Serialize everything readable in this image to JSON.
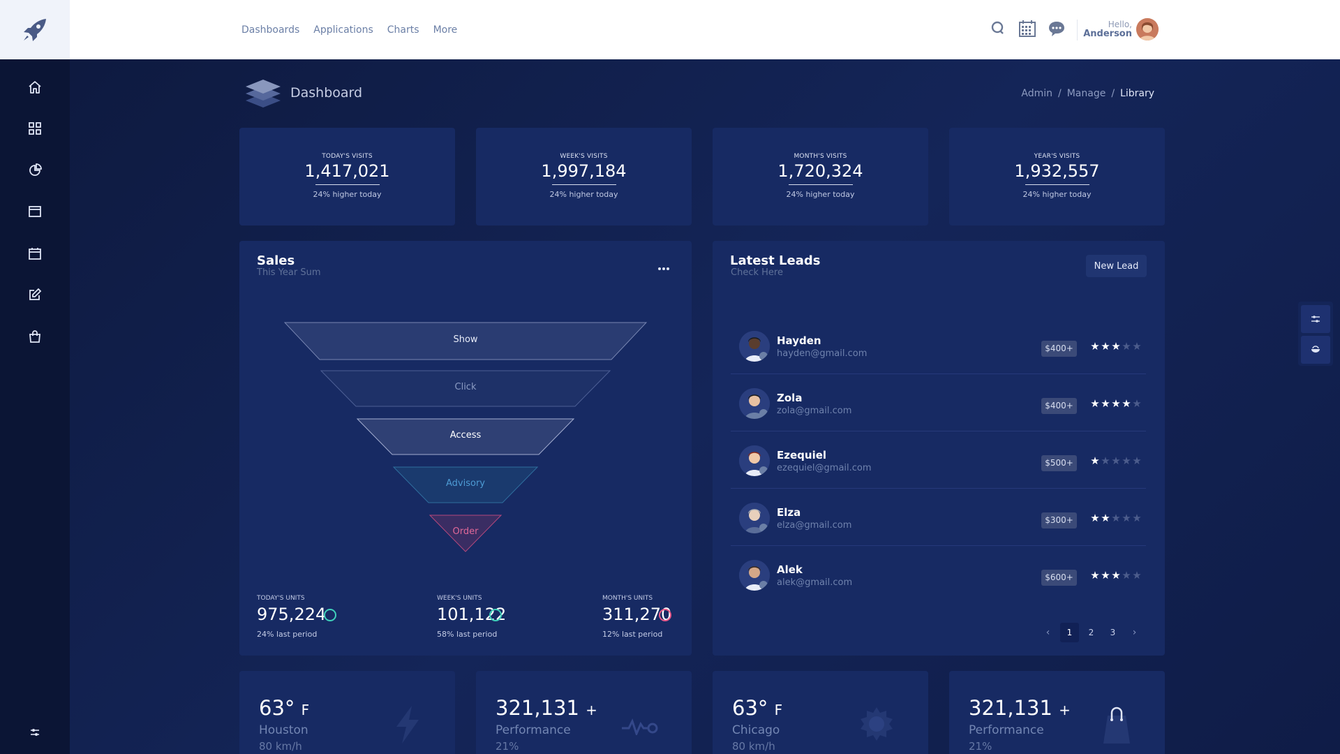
{
  "topnav": {
    "items": [
      "Dashboards",
      "Applications",
      "Charts",
      "More"
    ]
  },
  "user": {
    "greeting": "Hello,",
    "name": "Anderson"
  },
  "page": {
    "title": "Dashboard",
    "breadcrumb": [
      "Admin",
      "Manage",
      "Library"
    ],
    "separator": "/"
  },
  "stats": [
    {
      "label": "TODAY'S VISITS",
      "value": "1,417,021",
      "sub": "24% higher today"
    },
    {
      "label": "WEEK'S VISITS",
      "value": "1,997,184",
      "sub": "24% higher today"
    },
    {
      "label": "MONTH'S VISITS",
      "value": "1,720,324",
      "sub": "24% higher today"
    },
    {
      "label": "YEAR'S VISITS",
      "value": "1,932,557",
      "sub": "24% higher today"
    }
  ],
  "sales": {
    "title": "Sales",
    "subtitle": "This Year Sum",
    "funnel": [
      "Show",
      "Click",
      "Access",
      "Advisory",
      "Order"
    ],
    "units": [
      {
        "label": "TODAY'S UNITS",
        "value": "975,224",
        "sub": "24% last period",
        "ring_color": "#40d1bb"
      },
      {
        "label": "WEEK'S UNITS",
        "value": "101,122",
        "sub": "58% last period",
        "ring_color": "#40d1bb"
      },
      {
        "label": "MONTH'S UNITS",
        "value": "311,270",
        "sub": "12% last period",
        "ring_color": "#ea5a8a"
      }
    ]
  },
  "leads": {
    "title": "Latest Leads",
    "subtitle": "Check Here",
    "button": "New Lead",
    "rows": [
      {
        "name": "Hayden",
        "email": "hayden@gmail.com",
        "badge": "$400+",
        "rating": 3
      },
      {
        "name": "Zola",
        "email": "zola@gmail.com",
        "badge": "$400+",
        "rating": 4
      },
      {
        "name": "Ezequiel",
        "email": "ezequiel@gmail.com",
        "badge": "$500+",
        "rating": 1
      },
      {
        "name": "Elza",
        "email": "elza@gmail.com",
        "badge": "$300+",
        "rating": 2
      },
      {
        "name": "Alek",
        "email": "alek@gmail.com",
        "badge": "$600+",
        "rating": 3
      }
    ],
    "pages": [
      "1",
      "2",
      "3"
    ],
    "prev": "‹",
    "next": "›"
  },
  "bottom_cards": [
    {
      "value": "63°",
      "unit": "F",
      "label": "Houston",
      "sub": "80 km/h",
      "icon": "bolt-icon"
    },
    {
      "value": "321,131",
      "unit": "+",
      "label": "Performance",
      "sub": "21%",
      "icon": "pulse-icon"
    },
    {
      "value": "63°",
      "unit": "F",
      "label": "Chicago",
      "sub": "80 km/h",
      "icon": "sun-icon"
    },
    {
      "value": "321,131",
      "unit": "+",
      "label": "Performance",
      "sub": "21%",
      "icon": "bag-icon"
    }
  ],
  "colors": {
    "accent_teal": "#40d1bb",
    "accent_pink": "#ea5a8a",
    "card_bg": "#172a63",
    "sidebar_bg": "#0b1535"
  }
}
